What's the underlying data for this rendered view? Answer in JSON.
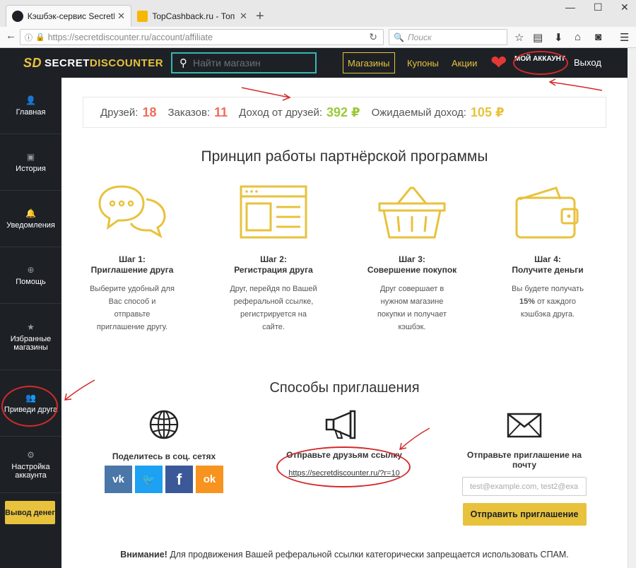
{
  "browser": {
    "tabs": [
      {
        "label": "Кэшбэк-сервис SecretDisco",
        "active": true
      },
      {
        "label": "TopCashback.ru - Топ лучш",
        "active": false
      }
    ],
    "url_host": "https://secretdiscounter.ru",
    "url_path": "/account/affiliate",
    "search_placeholder": "Поиск"
  },
  "header": {
    "logo_mark": "SD",
    "logo_word1": "SECRET",
    "logo_word2": "DISCOUNTER",
    "search_placeholder": "Найти магазин",
    "nav": [
      "Магазины",
      "Купоны",
      "Акции"
    ],
    "account": "МОЙ АККАУНТ",
    "logout": "Выход"
  },
  "sidebar": {
    "items": [
      {
        "label": "Главная",
        "icon": "user-icon"
      },
      {
        "label": "История",
        "icon": "book-icon"
      },
      {
        "label": "Уведомления",
        "icon": "bell-icon"
      },
      {
        "label": "Помощь",
        "icon": "lifebuoy-icon"
      },
      {
        "label": "Избранные магазины",
        "icon": "star-icon"
      },
      {
        "label": "Приведи друга",
        "icon": "users-icon"
      },
      {
        "label": "Настройка аккаунта",
        "icon": "gears-icon"
      }
    ],
    "withdraw": "Вывод денег"
  },
  "stats": {
    "friends_label": "Друзей:",
    "friends": "18",
    "orders_label": "Заказов:",
    "orders": "11",
    "income_label": "Доход от друзей:",
    "income": "392 ₽",
    "expected_label": "Ожидаемый доход:",
    "expected": "105 ₽"
  },
  "principle_title": "Принцип работы партнёрской программы",
  "steps": [
    {
      "title1": "Шаг 1:",
      "title2": "Приглашение друга",
      "desc": "Выберите удобный для Вас способ и отправьте приглашение другу.",
      "icon": "chat-bubbles-icon"
    },
    {
      "title1": "Шаг 2:",
      "title2": "Регистрация друга",
      "desc": "Друг, перейдя по Вашей реферальной ссылке, регистрируется на сайте.",
      "icon": "webpage-icon"
    },
    {
      "title1": "Шаг 3:",
      "title2": "Совершение покупок",
      "desc": "Друг совершает в нужном магазине покупки и получает кэшбэк.",
      "icon": "basket-icon"
    },
    {
      "title1": "Шаг 4:",
      "title2": "Получите деньги",
      "desc_pre": "Вы будете получать ",
      "desc_bold": "15%",
      "desc_post": " от каждого кэшбэка друга.",
      "icon": "wallet-icon"
    }
  ],
  "invite_title": "Способы приглашения",
  "ways": {
    "social_title": "Поделитесь в соц. сетях",
    "socials": [
      {
        "name": "vk",
        "glyph": "vk",
        "color": "#4a76a8"
      },
      {
        "name": "twitter",
        "glyph": "🐦",
        "color": "#1da1f2"
      },
      {
        "name": "facebook",
        "glyph": "f",
        "color": "#3b5998"
      },
      {
        "name": "odnoklassniki",
        "glyph": "ok",
        "color": "#f7931e"
      }
    ],
    "link_title": "Отправьте друзьям ссылку",
    "link": "https://secretdiscounter.ru/?r=10",
    "email_title": "Отправьте приглашение на почту",
    "email_placeholder": "test@example.com, test2@exa",
    "send_button": "Отправить приглашение"
  },
  "warning_bold": "Внимание!",
  "warning_text": " Для продвижения Вашей реферальной ссылки категорически запрещается использовать СПАМ."
}
